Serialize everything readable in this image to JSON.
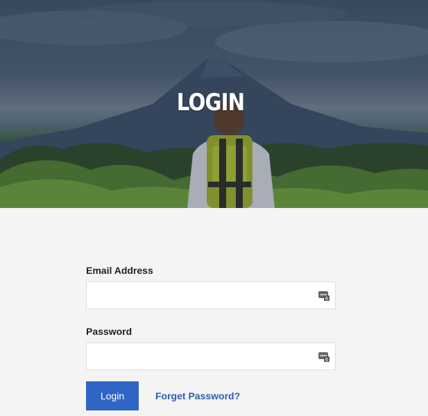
{
  "hero": {
    "title": "LOGIN"
  },
  "form": {
    "email": {
      "label": "Email Address",
      "value": "",
      "placeholder": "",
      "icon": "password-manager-icon"
    },
    "password": {
      "label": "Password",
      "value": "",
      "placeholder": "",
      "icon": "password-manager-icon"
    },
    "login_label": "Login",
    "forgot_label": "Forget Password?"
  },
  "colors": {
    "primary": "#2f66c4",
    "link": "#2f5fb3",
    "background": "#f4f4f4"
  }
}
